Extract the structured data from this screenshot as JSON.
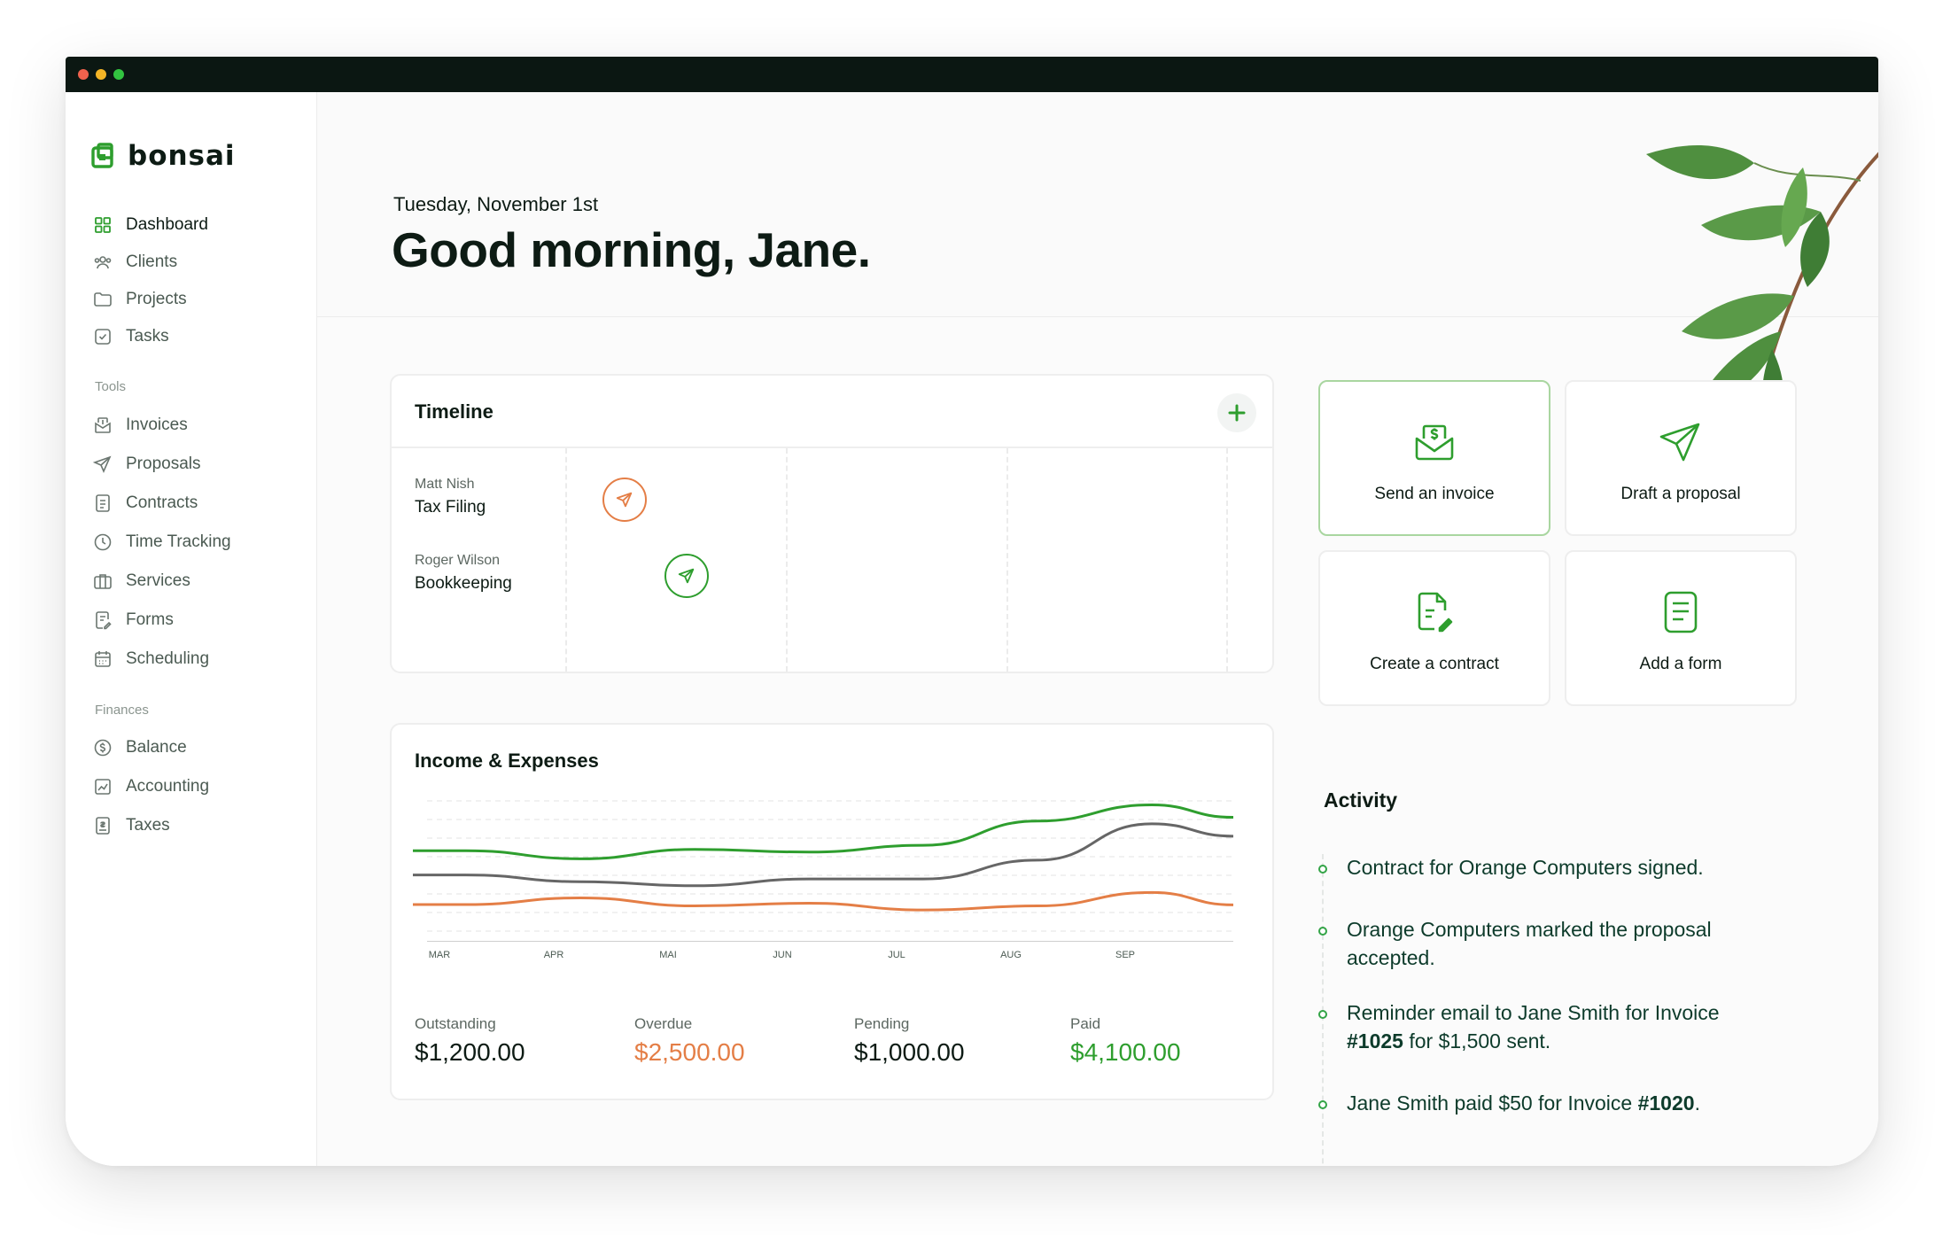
{
  "app": {
    "name": "bonsai"
  },
  "colors": {
    "brand": "#2e9e2e",
    "orange": "#e47e46",
    "gray": "#666666",
    "dark": "#0b1712"
  },
  "sidebar": {
    "items": [
      {
        "label": "Dashboard",
        "icon": "dashboard-icon"
      },
      {
        "label": "Clients",
        "icon": "clients-icon"
      },
      {
        "label": "Projects",
        "icon": "folder-icon"
      },
      {
        "label": "Tasks",
        "icon": "checkbox-icon"
      }
    ],
    "tools_heading": "Tools",
    "tools": [
      {
        "label": "Invoices",
        "icon": "invoice-icon"
      },
      {
        "label": "Proposals",
        "icon": "send-icon"
      },
      {
        "label": "Contracts",
        "icon": "document-icon"
      },
      {
        "label": "Time Tracking",
        "icon": "clock-icon"
      },
      {
        "label": "Services",
        "icon": "briefcase-icon"
      },
      {
        "label": "Forms",
        "icon": "form-icon"
      },
      {
        "label": "Scheduling",
        "icon": "calendar-icon"
      }
    ],
    "finances_heading": "Finances",
    "finances": [
      {
        "label": "Balance",
        "icon": "dollar-circle-icon"
      },
      {
        "label": "Accounting",
        "icon": "chart-icon"
      },
      {
        "label": "Taxes",
        "icon": "receipt-icon"
      }
    ]
  },
  "header": {
    "date": "Tuesday, November 1st",
    "greeting": "Good morning, Jane."
  },
  "timeline": {
    "title": "Timeline",
    "rows": [
      {
        "client": "Matt Nish",
        "task": "Tax Filing",
        "color": "#e47e46"
      },
      {
        "client": "Roger Wilson",
        "task": "Bookkeeping",
        "color": "#2e9e2e"
      }
    ]
  },
  "income": {
    "title": "Income & Expenses",
    "stats": [
      {
        "label": "Outstanding",
        "value": "$1,200.00",
        "color": "#0d1b14"
      },
      {
        "label": "Overdue",
        "value": "$2,500.00",
        "color": "#e47e46"
      },
      {
        "label": "Pending",
        "value": "$1,000.00",
        "color": "#0d1b14"
      },
      {
        "label": "Paid",
        "value": "$4,100.00",
        "color": "#2e9e2e"
      }
    ]
  },
  "chart_data": {
    "type": "line",
    "x": [
      "MAR",
      "APR",
      "MAI",
      "JUN",
      "JUL",
      "AUG",
      "SEP"
    ],
    "series": [
      {
        "color": "#2e9e2e",
        "values": [
          63,
          57,
          64,
          62,
          67,
          85,
          97
        ]
      },
      {
        "color": "#666666",
        "values": [
          45,
          40,
          37,
          42,
          42,
          56,
          83
        ]
      },
      {
        "color": "#e47e46",
        "values": [
          23,
          28,
          22,
          24,
          19,
          22,
          32
        ]
      }
    ],
    "ylim": [
      0,
      100
    ],
    "grid": true,
    "legend": false
  },
  "actions": [
    {
      "label": "Send an invoice",
      "icon": "invoice-dollar-icon"
    },
    {
      "label": "Draft a proposal",
      "icon": "paper-plane-icon"
    },
    {
      "label": "Create a contract",
      "icon": "contract-pen-icon"
    },
    {
      "label": "Add a form",
      "icon": "form-list-icon"
    }
  ],
  "activity": {
    "title": "Activity",
    "items": [
      {
        "text": "Contract for Orange Computers signed."
      },
      {
        "text": "Orange Computers marked the proposal accepted."
      },
      {
        "pre": "Reminder email to Jane Smith for Invoice ",
        "bold": "#1025",
        "post": " for $1,500 sent."
      },
      {
        "pre": "Jane Smith paid $50 for Invoice ",
        "bold": "#1020",
        "post": "."
      }
    ]
  }
}
